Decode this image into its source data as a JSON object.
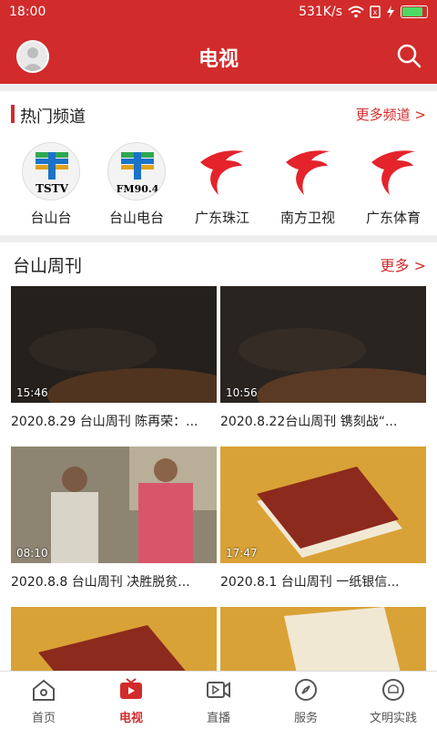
{
  "status": {
    "time": "18:00",
    "speed": "531K/s",
    "battery": 0.85
  },
  "header": {
    "title": "电视"
  },
  "hot_channels": {
    "title": "热门频道",
    "more": "更多频道 >",
    "items": [
      {
        "label": "台山台",
        "logo_text": "TSTV",
        "icon": "tstv-logo-icon"
      },
      {
        "label": "台山电台",
        "logo_text": "FM90.4",
        "icon": "fm-logo-icon"
      },
      {
        "label": "广东珠江",
        "icon": "guangdong-logo-icon"
      },
      {
        "label": "南方卫视",
        "icon": "guangdong-logo-icon"
      },
      {
        "label": "广东体育",
        "icon": "guangdong-logo-icon"
      }
    ]
  },
  "weekly": {
    "title": "台山周刊",
    "more": "更多 >",
    "videos": [
      {
        "duration": "15:46",
        "title": "2020.8.29 台山周刊 陈再荣：..."
      },
      {
        "duration": "10:56",
        "title": "2020.8.22台山周刊 镌刻战“..."
      },
      {
        "duration": "08:10",
        "title": "2020.8.8 台山周刊 决胜脱贫..."
      },
      {
        "duration": "17:47",
        "title": "2020.8.1 台山周刊 一纸银信..."
      }
    ]
  },
  "tabs": [
    {
      "label": "首页",
      "icon": "home-icon"
    },
    {
      "label": "电视",
      "icon": "tv-icon",
      "active": true
    },
    {
      "label": "直播",
      "icon": "live-video-icon"
    },
    {
      "label": "服务",
      "icon": "compass-icon"
    },
    {
      "label": "文明实践",
      "icon": "civilization-icon"
    }
  ],
  "colors": {
    "primary": "#d22b2b",
    "background": "#eeeeee"
  }
}
